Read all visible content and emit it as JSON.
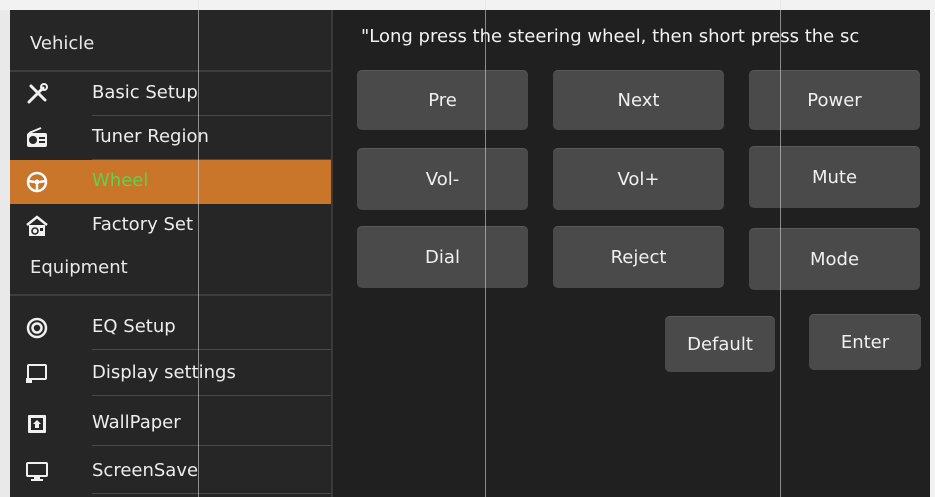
{
  "sidebar": {
    "section_vehicle": "Vehicle",
    "section_equipment": "Equipment",
    "vehicle_items": [
      {
        "label": "Basic Setup",
        "icon": "tools-icon"
      },
      {
        "label": "Tuner Region",
        "icon": "radio-icon"
      },
      {
        "label": "Wheel",
        "icon": "steering-wheel-icon",
        "active": true
      },
      {
        "label": "Factory Set",
        "icon": "factory-icon"
      }
    ],
    "equipment_items": [
      {
        "label": "EQ Setup",
        "icon": "eq-icon"
      },
      {
        "label": "Display settings",
        "icon": "display-icon"
      },
      {
        "label": "WallPaper",
        "icon": "wallpaper-icon"
      },
      {
        "label": "ScreenSave",
        "icon": "monitor-icon"
      }
    ]
  },
  "main": {
    "hint": "\"Long press the steering wheel, then short press the sc",
    "buttons": {
      "pre": "Pre",
      "next": "Next",
      "power": "Power",
      "vol_down": "Vol-",
      "vol_up": "Vol+",
      "mute": "Mute",
      "dial": "Dial",
      "reject": "Reject",
      "mode": "Mode"
    },
    "default": "Default",
    "enter": "Enter"
  },
  "colors": {
    "accent": "#c9762a",
    "active_text": "#5fd34a",
    "button": "#4a4a4a",
    "panel": "#202020"
  }
}
